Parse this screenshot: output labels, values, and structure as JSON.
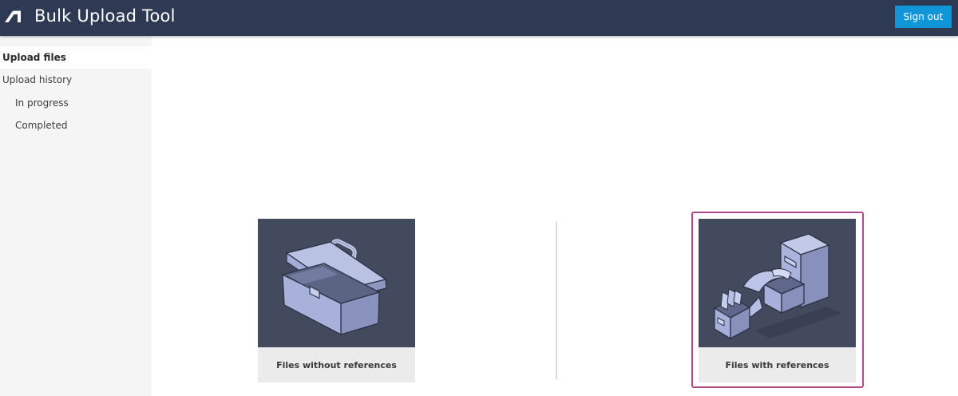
{
  "header": {
    "title": "Bulk Upload Tool",
    "signout_label": "Sign out",
    "bg_color": "#2e3a54",
    "button_color": "#0f96d8"
  },
  "sidebar": {
    "items": [
      {
        "label": "Upload files",
        "active": true
      },
      {
        "label": "Upload history",
        "active": false
      },
      {
        "label": "In progress",
        "active": false
      },
      {
        "label": "Completed",
        "active": false
      }
    ]
  },
  "main": {
    "cards": [
      {
        "label": "Files without references",
        "icon": "toolbox-icon",
        "selected": false
      },
      {
        "label": "Files with references",
        "icon": "file-cabinet-icon",
        "selected": true
      }
    ],
    "selection_color": "#b04a88"
  }
}
